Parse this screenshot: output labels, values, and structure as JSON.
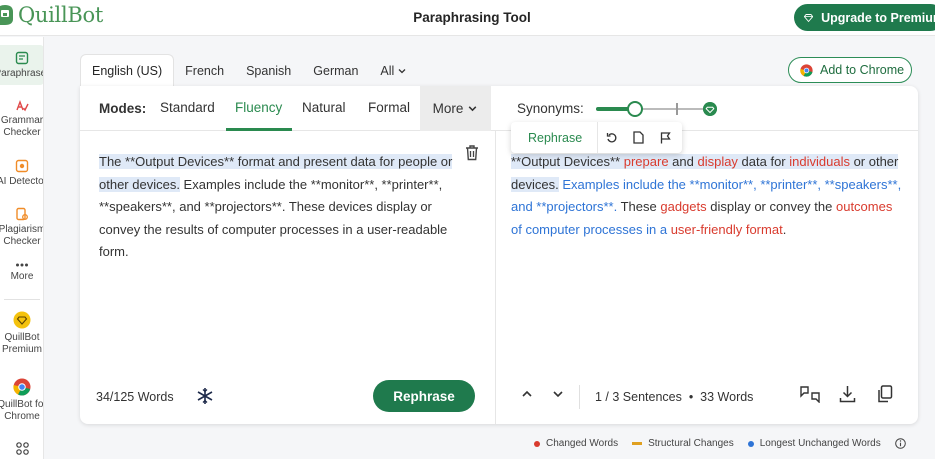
{
  "app": {
    "logo_text": "QuillBot",
    "page_title": "Paraphrasing Tool",
    "upgrade_label": "Upgrade to Premium",
    "brand_color": "#1f7a4d"
  },
  "sidebar": {
    "items": [
      {
        "label": "Paraphraser",
        "icon": "paraphraser-icon"
      },
      {
        "label": "Grammar Checker",
        "icon": "grammar-checker-icon"
      },
      {
        "label": "AI Detector",
        "icon": "ai-detector-icon"
      },
      {
        "label": "Plagiarism Checker",
        "icon": "plagiarism-checker-icon"
      },
      {
        "label": "More",
        "icon": "more-dots-icon"
      },
      {
        "label": "QuillBot Premium",
        "icon": "premium-diamond-icon"
      },
      {
        "label": "QuillBot for Chrome",
        "icon": "chrome-icon"
      }
    ]
  },
  "languages": {
    "tabs": [
      "English (US)",
      "French",
      "Spanish",
      "German"
    ],
    "all_label": "All",
    "active": "English (US)",
    "add_chrome_label": "Add to Chrome"
  },
  "modes": {
    "label": "Modes:",
    "items": [
      "Standard",
      "Fluency",
      "Natural",
      "Formal"
    ],
    "active": "Fluency",
    "more_label": "More",
    "synonyms_label": "Synonyms:",
    "synonyms_level": 0.35
  },
  "input": {
    "segments": [
      {
        "text": "The **Output Devices** format and present data for people or other devices.",
        "hl": true
      },
      {
        "text": " Examples include the **monitor**, **printer**, **speakers**, and **projectors**. These devices display or convey the results of computer processes in a user-readable form.",
        "hl": false
      }
    ],
    "word_count": "34/125 Words",
    "rephrase_label": "Rephrase"
  },
  "output": {
    "popup_rephrase_label": "Rephrase",
    "segments": [
      {
        "text": "**Output Devices** ",
        "type": "hl"
      },
      {
        "text": "prepare",
        "type": "changed-hl"
      },
      {
        "text": " and ",
        "type": "hl"
      },
      {
        "text": "display",
        "type": "changed-hl"
      },
      {
        "text": " data for ",
        "type": "hl"
      },
      {
        "text": "individuals",
        "type": "changed-hl"
      },
      {
        "text": " or other devices.",
        "type": "hl"
      },
      {
        "text": " ",
        "type": "plain"
      },
      {
        "text": "Examples include the **monitor**, **printer**, **speakers**, and **projectors**.",
        "type": "unchanged"
      },
      {
        "text": " These ",
        "type": "plain"
      },
      {
        "text": "gadgets",
        "type": "changed"
      },
      {
        "text": " display or convey the ",
        "type": "plain"
      },
      {
        "text": "outcomes",
        "type": "changed"
      },
      {
        "text": " of computer processes in a ",
        "type": "unchanged"
      },
      {
        "text": "user-friendly format",
        "type": "changed"
      },
      {
        "text": ".",
        "type": "plain"
      }
    ],
    "sentence_info": "1 / 3 Sentences",
    "word_info": "33 Words"
  },
  "legend": {
    "changed_label": "Changed Words",
    "structural_label": "Structural Changes",
    "unchanged_label": "Longest Unchanged Words",
    "changed_color": "#d93b2e",
    "structural_color": "#e0a020",
    "unchanged_color": "#2e74d6"
  }
}
